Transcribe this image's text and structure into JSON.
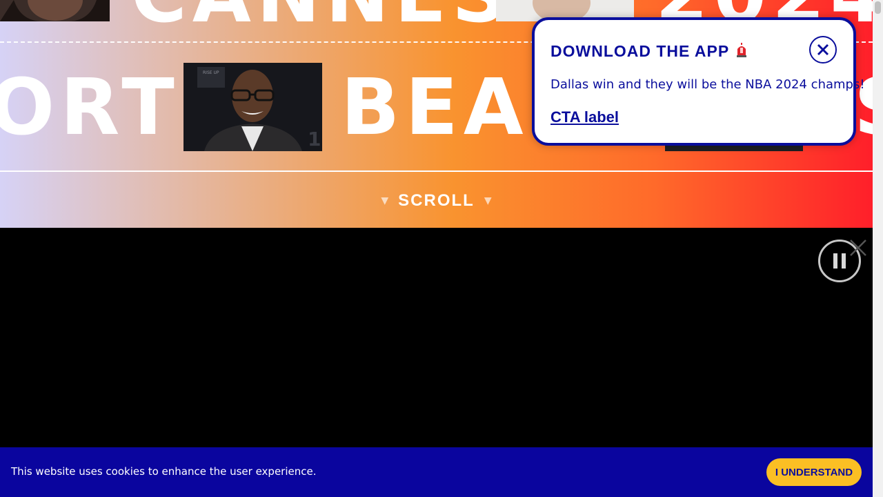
{
  "hero": {
    "word_ort": "ORT",
    "word_bea": "BEAC",
    "word_s": "S",
    "scroll_label": "SCROLL",
    "scroll_arrow_left": "▼",
    "scroll_arrow_right": "▼"
  },
  "popup": {
    "title": "DOWNLOAD THE APP",
    "title_icon": "siren-icon",
    "body": "Dallas win and they will be the NBA 2024 champs!",
    "cta": "CTA label",
    "close_icon": "close-icon"
  },
  "video": {
    "pause_icon": "pause-icon",
    "close_icon": "close-icon"
  },
  "cookie": {
    "text": "This website uses cookies to enhance the user experience.",
    "button": "I UNDERSTAND"
  },
  "colors": {
    "brand_navy": "#0a0e9c",
    "cookie_bg": "#0a059e",
    "button_yellow": "#fbbf24",
    "gradient_start": "#d6d2f6",
    "gradient_mid": "#f9932f",
    "gradient_end": "#ff1f2a"
  }
}
